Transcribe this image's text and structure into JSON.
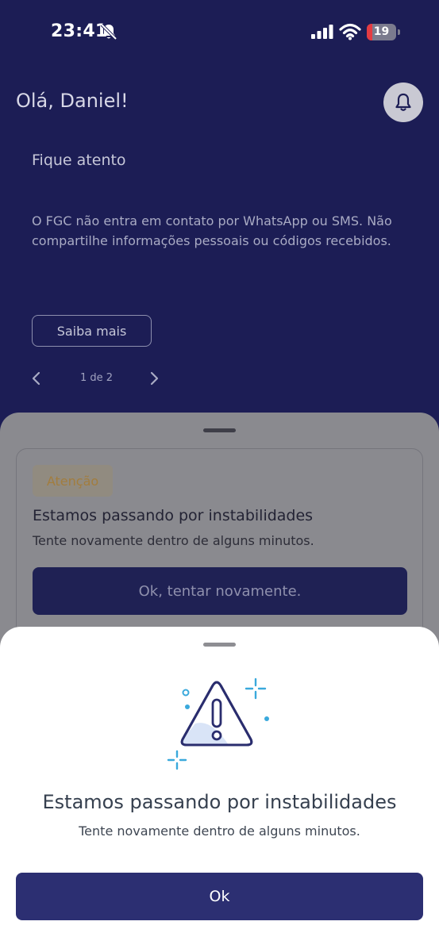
{
  "status_bar": {
    "time": "23:41",
    "battery_level": "19",
    "battery_fraction": 0.19,
    "icons": [
      "bell-slash-icon",
      "cellular-signal-icon",
      "wifi-icon",
      "battery-icon"
    ]
  },
  "header": {
    "greeting": "Olá, Daniel!",
    "notification_icon": "bell-icon"
  },
  "banner": {
    "title": "Fique atento",
    "text": "O FGC não entra em contato por WhatsApp ou SMS. Não compartilhe informações pessoais ou códigos recebidos.",
    "button_label": "Saiba mais",
    "pager": {
      "label": "1 de 2",
      "prev_icon": "chevron-left-icon",
      "next_icon": "chevron-right-icon"
    }
  },
  "alert_card": {
    "badge": "Atenção",
    "title": "Estamos passando por instabilidades",
    "text": "Tente novamente dentro de alguns minutos.",
    "button_label": "Ok, tentar novamente."
  },
  "modal": {
    "icon": "warning-triangle-icon",
    "title": "Estamos passando por instabilidades",
    "text": "Tente novamente dentro de alguns minutos.",
    "button_label": "Ok"
  },
  "colors": {
    "background_navy": "#1c1d55",
    "primary_button": "#2c2f72",
    "sparkle_accent": "#3aa9dc",
    "battery_red": "#e53b42",
    "badge_text": "#a27d3e"
  }
}
